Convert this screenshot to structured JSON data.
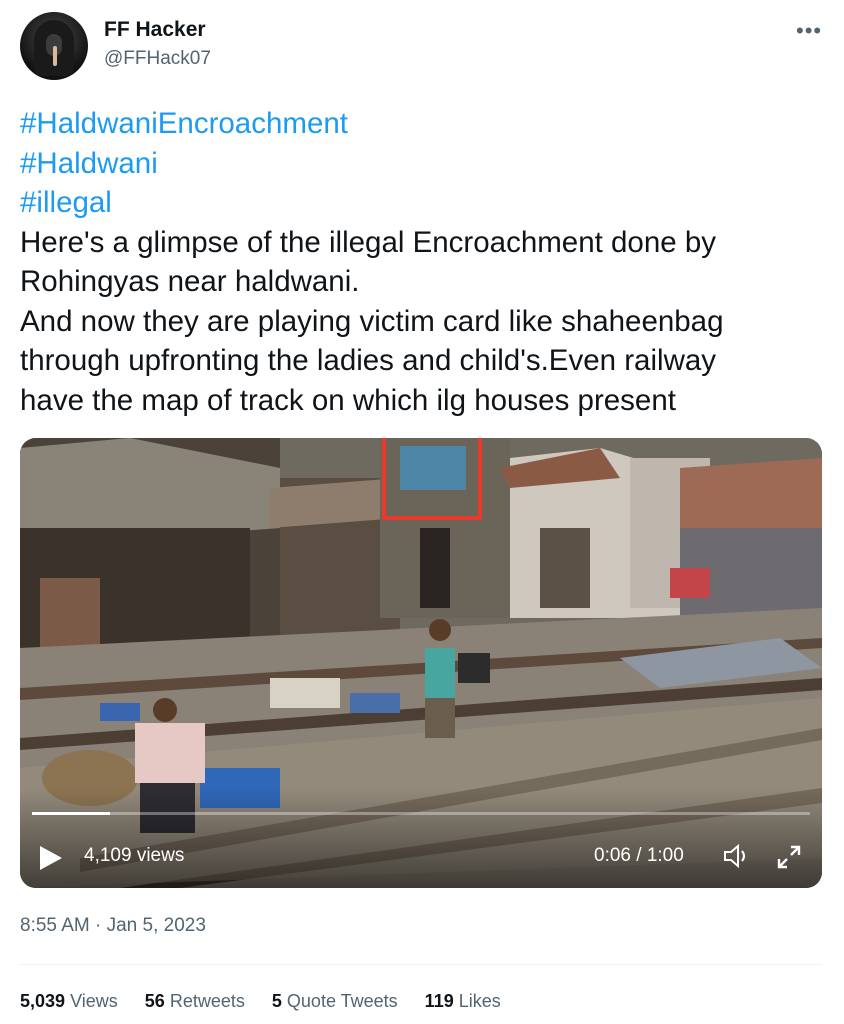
{
  "author": {
    "name": "FF Hacker",
    "handle": "@FFHack07"
  },
  "more_icon": "ellipsis-icon",
  "tweet": {
    "hashtags": [
      "#HaldwaniEncroachment",
      "#Haldwani",
      "#illegal"
    ],
    "lines": [
      "Here's a glimpse of the illegal Encroachment done by",
      "Rohingyas near haldwani.",
      "And now they are playing victim card like shaheenbag",
      "through upfronting the ladies and child's.Even railway",
      "have the map of track on which ilg houses present"
    ]
  },
  "video": {
    "views": "4,109 views",
    "time": "0:06 / 1:00",
    "progress_fraction": 0.1,
    "icons": [
      "play-icon",
      "volume-icon",
      "fullscreen-icon"
    ],
    "highlight_color": "#e8392b"
  },
  "timestamp": "8:55 AM · Jan 5, 2023",
  "stats": {
    "views_count": "5,039",
    "views_label": "Views",
    "retweets_count": "56",
    "retweets_label": "Retweets",
    "quotes_count": "5",
    "quotes_label": "Quote Tweets",
    "likes_count": "119",
    "likes_label": "Likes"
  },
  "colors": {
    "hashtag": "#1d9bf0",
    "secondary_text": "#536471"
  }
}
